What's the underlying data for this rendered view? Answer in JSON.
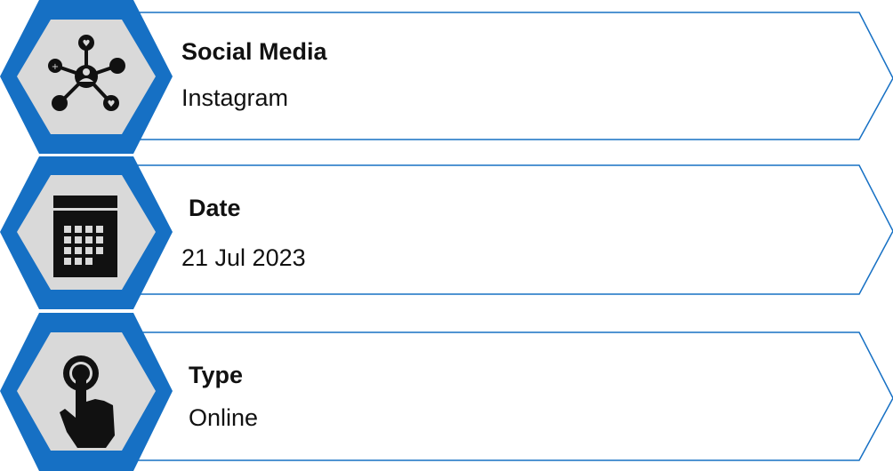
{
  "cards": [
    {
      "title": "Social Media",
      "value": "Instagram",
      "icon": "social-network-icon"
    },
    {
      "title": "Date",
      "value": "21 Jul 2023",
      "icon": "calendar-icon"
    },
    {
      "title": "Type",
      "value": "Online",
      "icon": "pointing-hand-icon"
    }
  ],
  "colors": {
    "hexagon_outer": "#1670c4",
    "hexagon_inner": "#d9d9d9",
    "frame_stroke": "#1670c4",
    "icon": "#111111"
  }
}
